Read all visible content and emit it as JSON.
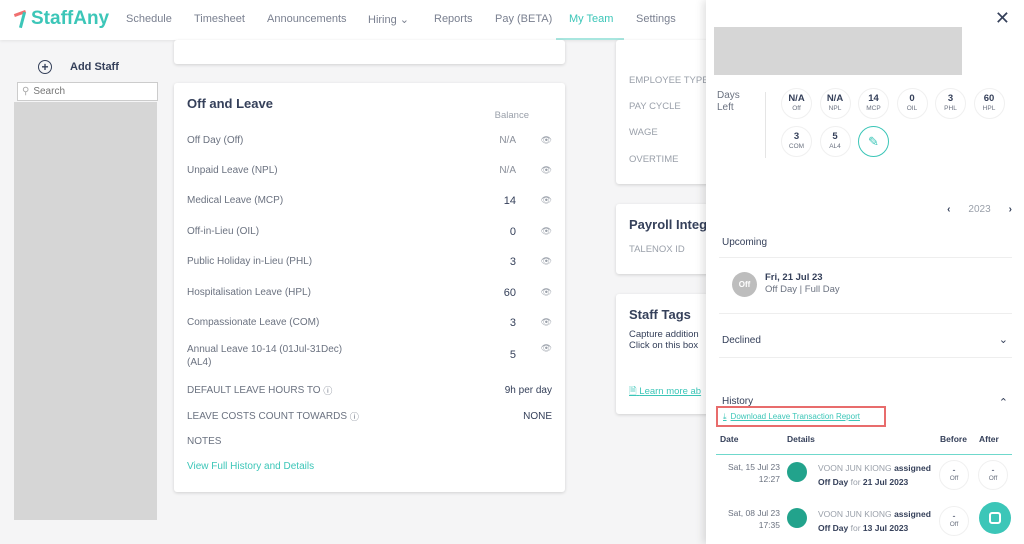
{
  "nav": {
    "brand": "StaffAny",
    "items": [
      "Schedule",
      "Timesheet",
      "Announcements",
      "Hiring",
      "Reports",
      "Pay (BETA)",
      "My Team",
      "Settings"
    ],
    "active": "My Team"
  },
  "sidebar": {
    "add_staff": "Add Staff",
    "search_placeholder": "Search"
  },
  "leave_card": {
    "title": "Off and Leave",
    "balance_header": "Balance",
    "rows": [
      {
        "label": "Off Day (Off)",
        "value": "N/A"
      },
      {
        "label": "Unpaid Leave (NPL)",
        "value": "N/A"
      },
      {
        "label": "Medical Leave (MCP)",
        "value": "14"
      },
      {
        "label": "Off-in-Lieu (OIL)",
        "value": "0"
      },
      {
        "label": "Public Holiday in-Lieu (PHL)",
        "value": "3"
      },
      {
        "label": "Hospitalisation Leave (HPL)",
        "value": "60"
      },
      {
        "label": "Compassionate Leave (COM)",
        "value": "3"
      },
      {
        "label": "Annual Leave 10-14 (01Jul-31Dec) (AL4)",
        "value": "5"
      }
    ],
    "default_hours_label": "DEFAULT LEAVE HOURS TO",
    "default_hours_value": "9h per day",
    "costs_label": "LEAVE COSTS COUNT TOWARDS",
    "costs_value": "NONE",
    "notes_label": "NOTES",
    "view_link": "View Full History and Details"
  },
  "employment_card": {
    "fields": [
      "EMPLOYEE TYPE",
      "PAY CYCLE",
      "WAGE",
      "OVERTIME"
    ]
  },
  "payroll_card": {
    "title": "Payroll Integ",
    "field": "TALENOX ID"
  },
  "tags_card": {
    "title": "Staff Tags",
    "desc1": "Capture addition",
    "desc2": "Click on this box",
    "link": "Learn more ab"
  },
  "drawer": {
    "days_left": "Days Left",
    "balances": [
      {
        "v": "N/A",
        "k": "Off"
      },
      {
        "v": "N/A",
        "k": "NPL"
      },
      {
        "v": "14",
        "k": "MCP"
      },
      {
        "v": "0",
        "k": "OIL"
      },
      {
        "v": "3",
        "k": "PHL"
      },
      {
        "v": "60",
        "k": "HPL"
      },
      {
        "v": "3",
        "k": "COM"
      },
      {
        "v": "5",
        "k": "AL4"
      }
    ],
    "year": "2023",
    "upcoming": "Upcoming",
    "upcoming_item": {
      "badge": "Off",
      "date": "Fri, 21 Jul 23",
      "desc": "Off Day | Full Day"
    },
    "declined": "Declined",
    "history": "History",
    "download": "Download Leave Transaction Report",
    "columns": [
      "Date",
      "Details",
      "Before",
      "After"
    ],
    "history_rows": [
      {
        "date": "Sat, 15 Jul 23",
        "time": "12:27",
        "actor": "VOON JUN KIONG",
        "action": "assigned",
        "type": "Off Day",
        "for": "for",
        "target": "21 Jul 2023",
        "before": "-",
        "before_k": "Off",
        "after": "-",
        "after_k": "Off"
      },
      {
        "date": "Sat, 08 Jul 23",
        "time": "17:35",
        "actor": "VOON JUN KIONG",
        "action": "assigned",
        "type": "Off Day",
        "for": "for",
        "target": "13 Jul 2023",
        "before": "-",
        "before_k": "Off"
      }
    ]
  },
  "colors": {
    "accent": "#3cc6b8",
    "highlight": "#e86c6c"
  }
}
